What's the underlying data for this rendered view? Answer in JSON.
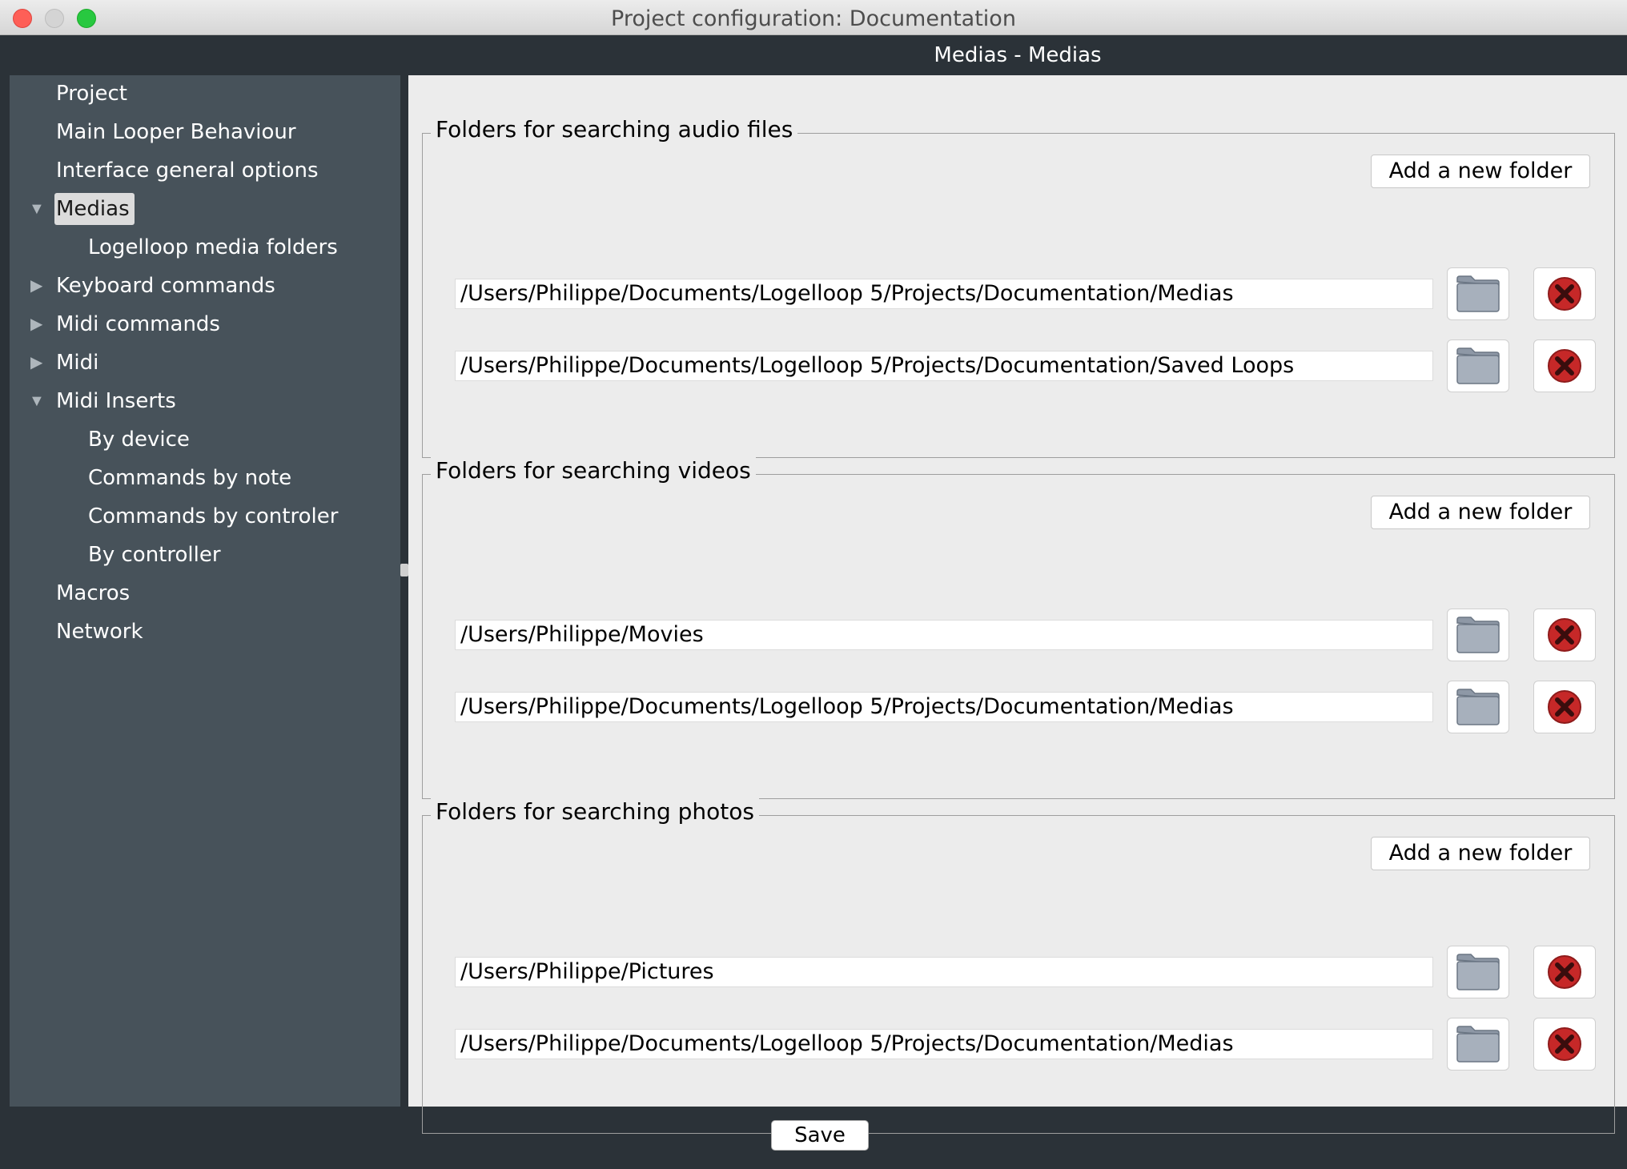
{
  "window": {
    "title": "Project configuration: Documentation"
  },
  "panel": {
    "title": "Medias - Medias"
  },
  "sidebar": {
    "items": [
      {
        "label": "Project",
        "expander": "none",
        "selected": false
      },
      {
        "label": "Main Looper Behaviour",
        "expander": "none",
        "selected": false
      },
      {
        "label": "Interface general options",
        "expander": "none",
        "selected": false
      },
      {
        "label": "Medias",
        "expander": "expanded",
        "selected": true
      },
      {
        "label": "Logelloop media folders",
        "expander": "none",
        "selected": false
      },
      {
        "label": "Keyboard commands",
        "expander": "collapsed",
        "selected": false
      },
      {
        "label": "Midi commands",
        "expander": "collapsed",
        "selected": false
      },
      {
        "label": "Midi",
        "expander": "collapsed",
        "selected": false
      },
      {
        "label": "Midi Inserts",
        "expander": "expanded",
        "selected": false
      },
      {
        "label": "By device",
        "expander": "none",
        "selected": false
      },
      {
        "label": "Commands by note",
        "expander": "none",
        "selected": false
      },
      {
        "label": "Commands by controler",
        "expander": "none",
        "selected": false
      },
      {
        "label": "By controller",
        "expander": "none",
        "selected": false
      },
      {
        "label": "Macros",
        "expander": "none",
        "selected": false
      },
      {
        "label": "Network",
        "expander": "none",
        "selected": false
      }
    ]
  },
  "groups": [
    {
      "title": "Folders for searching audio files",
      "add_label": "Add a new folder",
      "folders": [
        "/Users/Philippe/Documents/Logelloop 5/Projects/Documentation/Medias",
        "/Users/Philippe/Documents/Logelloop 5/Projects/Documentation/Saved Loops"
      ]
    },
    {
      "title": "Folders for searching videos",
      "add_label": "Add a new folder",
      "folders": [
        "/Users/Philippe/Movies",
        "/Users/Philippe/Documents/Logelloop 5/Projects/Documentation/Medias"
      ]
    },
    {
      "title": "Folders for searching photos",
      "add_label": "Add a new folder",
      "folders": [
        "/Users/Philippe/Pictures",
        "/Users/Philippe/Documents/Logelloop 5/Projects/Documentation/Medias"
      ]
    }
  ],
  "footer": {
    "save_label": "Save"
  },
  "icons": {
    "browse": "folder-icon",
    "remove": "delete-icon"
  },
  "colors": {
    "sidebar_bg": "#47525a",
    "app_bg": "#2b3238",
    "delete_red": "#c62828"
  }
}
